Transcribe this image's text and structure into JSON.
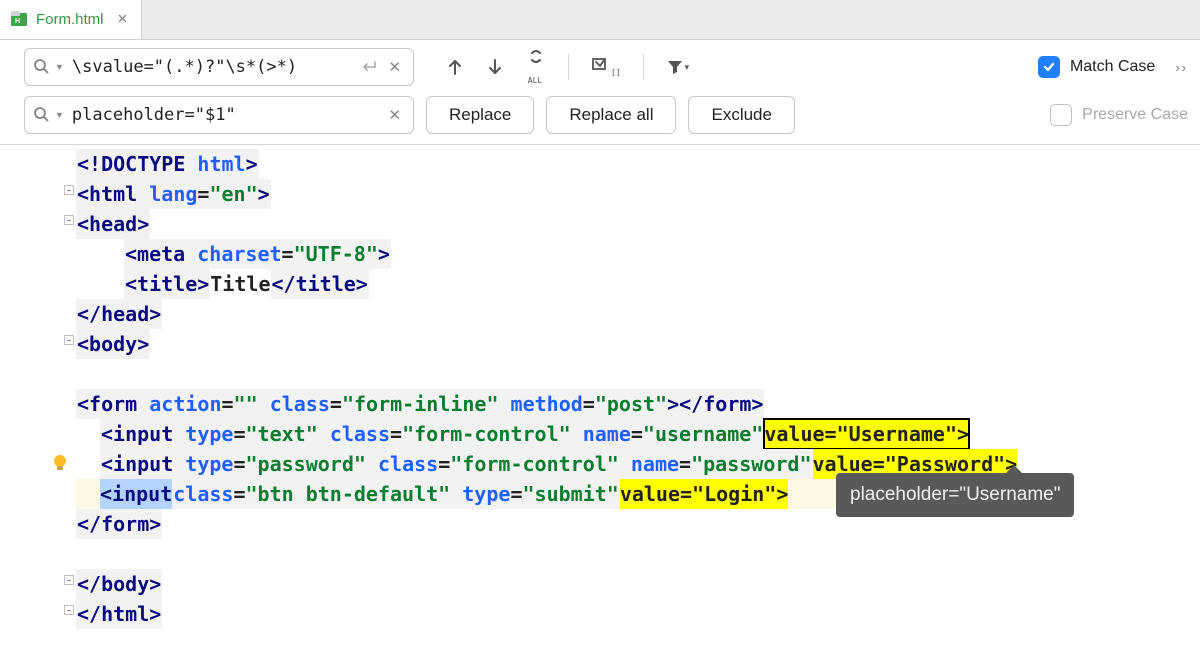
{
  "tab": {
    "filename": "Form.html"
  },
  "search": {
    "find_value": "\\svalue=\"(.*)?\"\\s*(>*)",
    "replace_value": "placeholder=\"$1\""
  },
  "options": {
    "match_case_label": "Match Case",
    "match_case_checked": true,
    "preserve_case_label": "Preserve Case",
    "preserve_case_checked": false
  },
  "buttons": {
    "replace": "Replace",
    "replace_all": "Replace all",
    "exclude": "Exclude"
  },
  "tooltip": {
    "text": "placeholder=\"Username\""
  },
  "code": {
    "l1_doctype": "<!DOCTYPE ",
    "l1_html": "html",
    "l1_end": ">",
    "l2_open": "<html ",
    "l2_attr": "lang",
    "l2_eq": "=",
    "l2_val": "\"en\"",
    "l2_end": ">",
    "l3": "<head>",
    "l4_open": "<meta ",
    "l4_attr": "charset",
    "l4_eq": "=",
    "l4_val": "\"UTF-8\"",
    "l4_end": ">",
    "l5_open": "<title>",
    "l5_text": "Title",
    "l5_close": "</title>",
    "l6": "</head>",
    "l7": "<body>",
    "l9_open": "<form ",
    "l9_a1": "action",
    "l9_v1": "\"\"",
    "l9_a2": "class",
    "l9_v2": "\"form-inline\"",
    "l9_a3": "method",
    "l9_v3": "\"post\"",
    "l9_close": "></form>",
    "l10_open": "<input ",
    "l10_a1": "type",
    "l10_v1": "\"text\"",
    "l10_a2": "class",
    "l10_v2": "\"form-control\"",
    "l10_a3": "name",
    "l10_v3": "\"username\"",
    "l10_match": " value=\"Username\">",
    "l11_open": "<input ",
    "l11_a1": "type",
    "l11_v1": "\"password\"",
    "l11_a2": "class",
    "l11_v2": "\"form-control\"",
    "l11_a3": "name",
    "l11_v3": "\"password\"",
    "l11_match": " value=\"Password\">",
    "l12_open": "<input ",
    "l12_a1": "class",
    "l12_v1": "\"btn btn-default\"",
    "l12_a2": "type",
    "l12_v2": "\"submit\"",
    "l12_match": " value=\"Login\">",
    "l13": "</form>",
    "l15": "</body>",
    "l16": "</html>"
  }
}
